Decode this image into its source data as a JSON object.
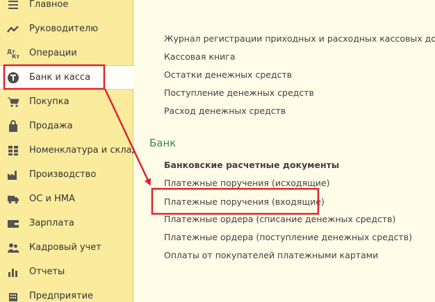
{
  "sidebar": {
    "items": [
      {
        "label": "Главное",
        "icon": "menu-lines-icon"
      },
      {
        "label": "Руководителю",
        "icon": "trend-line-icon"
      },
      {
        "label": "Операции",
        "icon": "debit-credit-icon"
      },
      {
        "label": "Банк и касса",
        "icon": "bank-coin-icon",
        "active": true
      },
      {
        "label": "Покупка",
        "icon": "shopping-cart-icon"
      },
      {
        "label": "Продажа",
        "icon": "shopping-bag-icon"
      },
      {
        "label": "Номенклатура и склад",
        "icon": "warehouse-blocks-icon"
      },
      {
        "label": "Производство",
        "icon": "factory-icon"
      },
      {
        "label": "ОС и НМА",
        "icon": "truck-icon"
      },
      {
        "label": "Зарплата",
        "icon": "wallet-icon"
      },
      {
        "label": "Кадровый учет",
        "icon": "people-icon"
      },
      {
        "label": "Отчеты",
        "icon": "bar-chart-icon"
      },
      {
        "label": "Предприятие",
        "icon": "building-icon"
      }
    ]
  },
  "content": {
    "kassa_links": [
      "Журнал регистрации приходных и расходных кассовых докумен",
      "Кассовая книга",
      "Остатки денежных средств",
      "Поступление денежных средств",
      "Расход денежных средств"
    ],
    "bank_section": {
      "title": "Банк",
      "heading": "Банковские расчетные документы",
      "links": [
        "Платежные поручения (исходящие)",
        "Платежные поручения (входящие)",
        "Платежные ордера (списание денежных средств)",
        "Платежные ордера (поступление денежных средств)",
        "Оплаты от покупателей платежными картами"
      ]
    }
  },
  "colors": {
    "sidebar_bg": "#fbec9d",
    "content_bg": "#fffde8",
    "section_title": "#2f8f46",
    "highlight": "#e0222a"
  }
}
